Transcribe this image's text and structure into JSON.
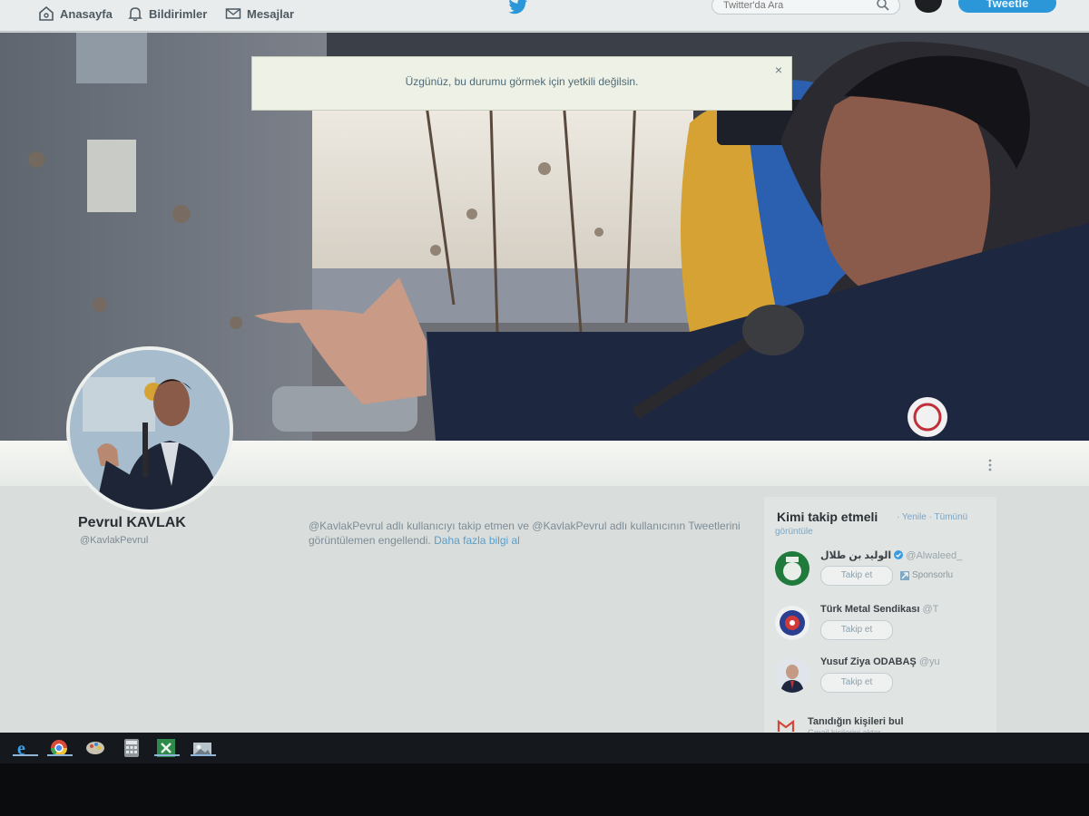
{
  "nav": {
    "home_label": "Anasayfa",
    "notifications_label": "Bildirimler",
    "messages_label": "Mesajlar",
    "search_placeholder": "Twitter'da Ara",
    "tweet_button": "Tweetle"
  },
  "toast": {
    "message": "Üzgünüz, bu durumu görmek için yetkili değilsin."
  },
  "profile": {
    "name": "Pevrul KAVLAK",
    "handle": "@KavlakPevrul",
    "blocked_text": "@KavlakPevrul adlı kullanıcıyı takip etmen ve @KavlakPevrul adlı kullanıcının Tweetlerini görüntülemen engellendi.",
    "learn_more": "Daha fazla bilgi al"
  },
  "who_to_follow": {
    "title": "Kimi takip etmeli",
    "refresh": "· Yenile ·",
    "view_all": "Tümünü",
    "view_all_2": "görüntüle",
    "suggestions": [
      {
        "name": "الوليد بن طلال",
        "handle": "@Alwaleed_",
        "button": "Takip et",
        "promoted": "Sponsorlu"
      },
      {
        "name": "Türk Metal Sendikası",
        "handle": "@T",
        "button": "Takip et"
      },
      {
        "name": "Yusuf Ziya ODABAŞ",
        "handle": "@yu",
        "button": "Takip et"
      }
    ],
    "find_title": "Tanıdığın kişileri bul",
    "find_sub": "Gmail kişilerini aktar"
  },
  "colors": {
    "accent": "#2b97d8",
    "link": "#5b9dc7",
    "taskbar": "#15181c"
  },
  "icons": [
    "home-icon",
    "bell-icon",
    "envelope-icon",
    "twitter-bird-icon",
    "search-icon",
    "verified-icon",
    "gmail-icon",
    "ie-icon",
    "chrome-icon",
    "paint-icon",
    "calculator-icon",
    "excel-icon",
    "pictures-icon"
  ]
}
